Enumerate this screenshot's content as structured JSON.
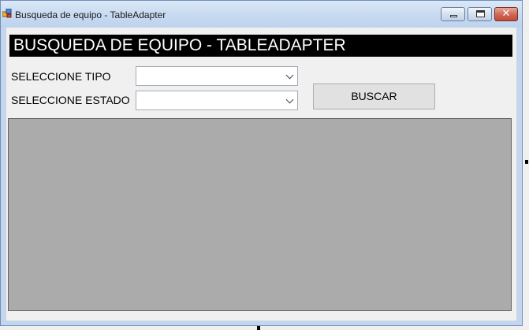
{
  "window": {
    "title": "Busqueda de equipo - TableAdapter",
    "controls": {
      "minimize": "minimize",
      "maximize": "maximize",
      "close": "close"
    }
  },
  "form": {
    "header": "BUSQUEDA DE EQUIPO - TABLEADAPTER",
    "tipo": {
      "label": "SELECCIONE TIPO",
      "value": ""
    },
    "estado": {
      "label": "SELECCIONE ESTADO",
      "value": ""
    },
    "search_button": "BUSCAR"
  },
  "colors": {
    "header_bg": "#000000",
    "header_text": "#ffffff",
    "grid_bg": "#ababab",
    "form_bg": "#f0f0f0"
  },
  "icons": {
    "app": "app-form-icon",
    "dropdown": "chevron-down-icon"
  }
}
